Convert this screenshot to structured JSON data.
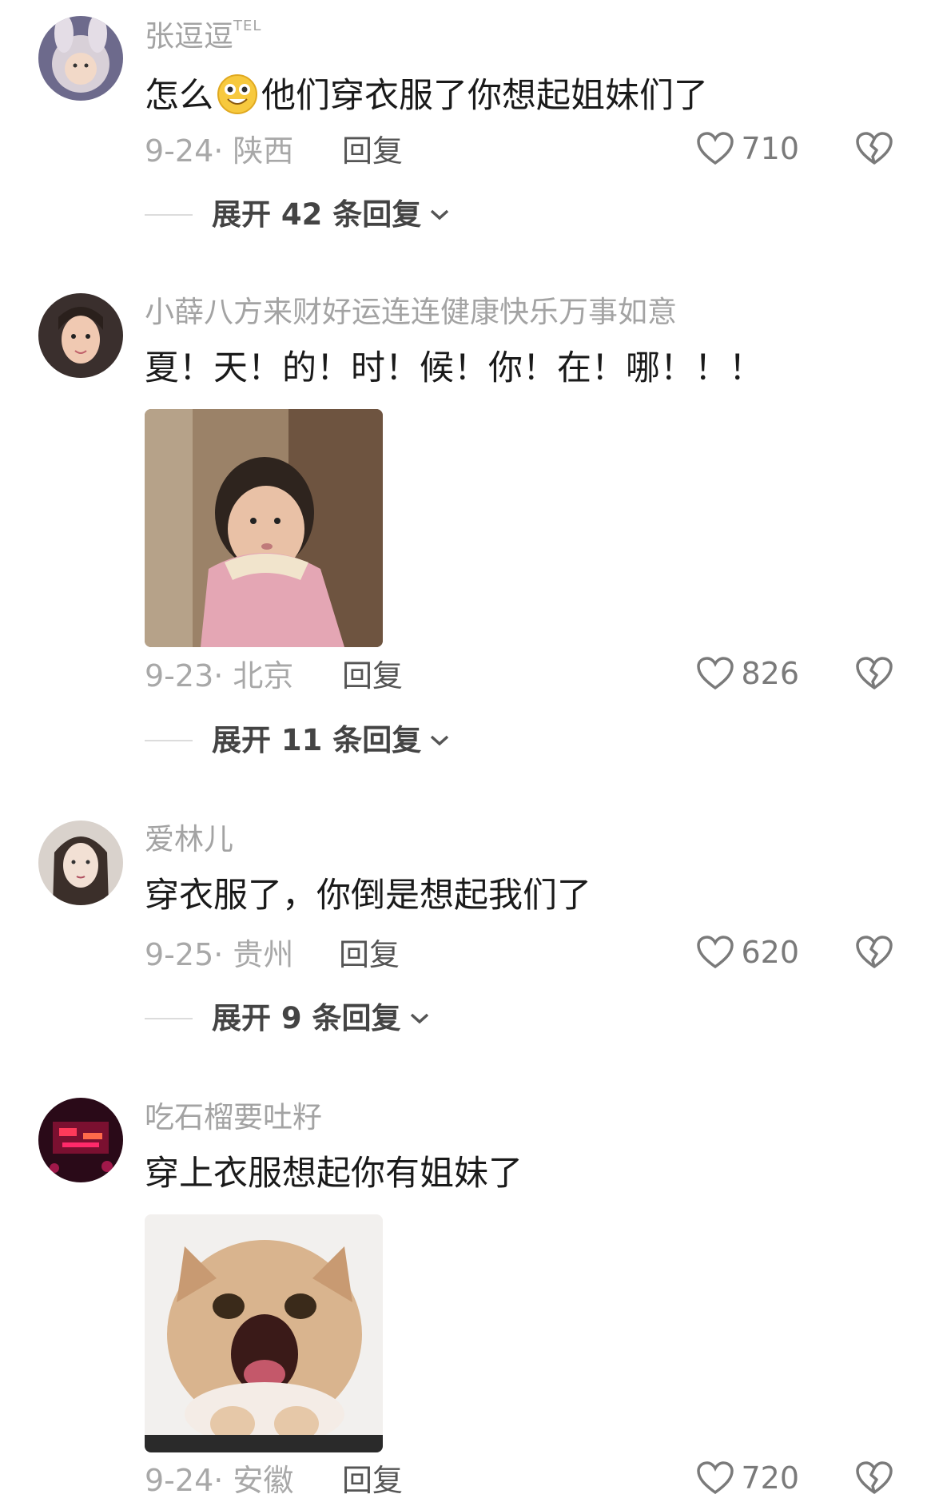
{
  "comments": [
    {
      "username": "张逗逗",
      "badge": "TEL",
      "text_before_emoji": "怎么",
      "emoji": "grinning-emoji",
      "text_after_emoji": "他们穿衣服了你想起姐妹们了",
      "date": "9-24",
      "location": "陕西",
      "reply_label": "回复",
      "likes": "710",
      "expand_label": "展开 42 条回复"
    },
    {
      "username": "小薛八方来财好运连连健康快乐万事如意",
      "text": "夏！天！的！时！候！你！在！哪！！！",
      "image": "child-in-pink-jacket-photo",
      "date": "9-23",
      "location": "北京",
      "reply_label": "回复",
      "likes": "826",
      "expand_label": "展开 11 条回复"
    },
    {
      "username": "爱林儿",
      "text": "穿衣服了，你倒是想起我们了",
      "date": "9-25",
      "location": "贵州",
      "reply_label": "回复",
      "likes": "620",
      "expand_label": "展开 9 条回复"
    },
    {
      "username": "吃石榴要吐籽",
      "text": "穿上衣服想起你有姐妹了",
      "image": "screaming-cat-photo",
      "date": "9-24",
      "location": "安徽",
      "reply_label": "回复",
      "likes": "720"
    }
  ],
  "colors": {
    "username": "#a3a3a3",
    "text": "#1a1a1a",
    "meta": "#a8a8a8",
    "icon": "#7a7a7a"
  }
}
